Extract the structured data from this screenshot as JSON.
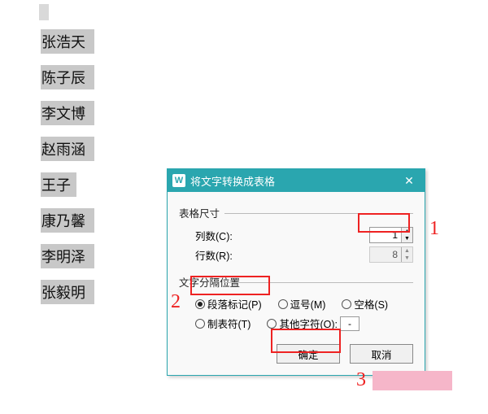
{
  "document": {
    "names": [
      "张浩天",
      "陈子辰",
      "李文博",
      "赵雨涵",
      "王子",
      "康乃馨",
      "李明泽",
      "张毅明"
    ]
  },
  "dialog": {
    "title": "将文字转换成表格",
    "close": "✕",
    "group_size": "表格尺寸",
    "columns_label": "列数(C):",
    "columns_value": "1",
    "rows_label": "行数(R):",
    "rows_value": "8",
    "group_sep": "文字分隔位置",
    "radio_paragraph": "段落标记(P)",
    "radio_comma": "逗号(M)",
    "radio_space": "空格(S)",
    "radio_tab": "制表符(T)",
    "radio_other": "其他字符(O):",
    "other_value": "-",
    "ok": "确定",
    "cancel": "取消"
  },
  "annotations": {
    "a1": "1",
    "a2": "2",
    "a3": "3"
  }
}
